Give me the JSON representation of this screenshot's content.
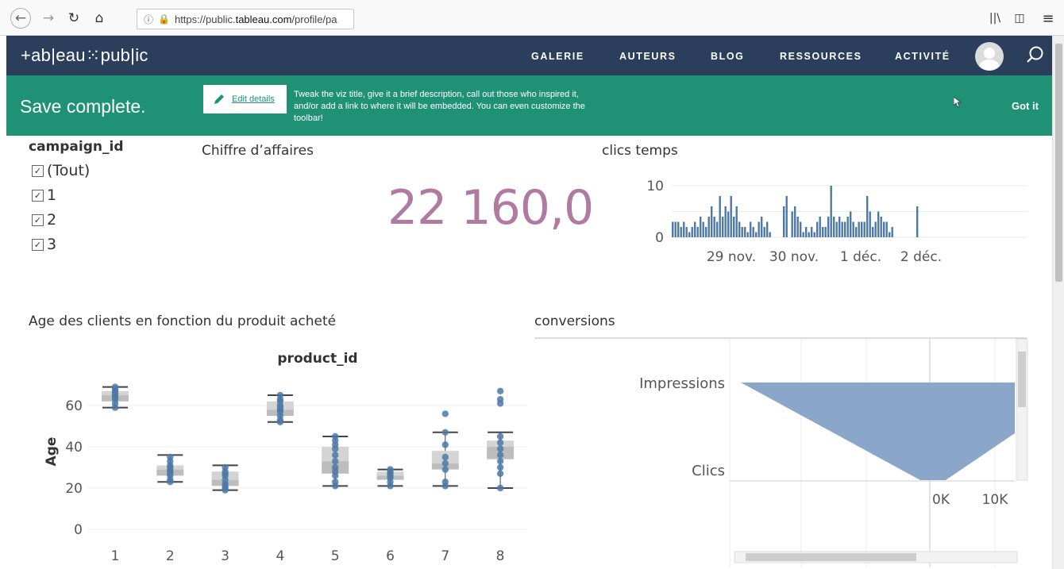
{
  "browser": {
    "url_prefix": "https://public.",
    "url_domain": "tableau.com",
    "url_path": "/profile/pa"
  },
  "header": {
    "logo": "+ableauⁱ⁺⁺public",
    "logo_text": "+ab|eau⁙pub|ic",
    "nav": [
      "GALERIE",
      "AUTEURS",
      "BLOG",
      "RESSOURCES",
      "ACTIVITÉ"
    ]
  },
  "banner": {
    "title": "Save complete.",
    "edit_label": "Edit details",
    "description": "Tweak the viz title, give it a brief description, call out those who inspired it, and/or add a link to where it will be embedded. You can even customize the toolbar!",
    "dismiss": "Got it"
  },
  "filter": {
    "title": "campaign_id",
    "items": [
      {
        "label": "(Tout)",
        "checked": true
      },
      {
        "label": "1",
        "checked": true
      },
      {
        "label": "2",
        "checked": true
      },
      {
        "label": "3",
        "checked": true
      }
    ]
  },
  "kpi": {
    "title": "Chiffre d’affaires",
    "value": "22 160,0"
  },
  "colors": {
    "header_bg": "#2b3f5c",
    "banner_bg": "#1f9276",
    "kpi": "#b07aa1",
    "mark": "#4e79a7",
    "funnel": "#8aa6c8"
  },
  "chart_data": [
    {
      "type": "bar",
      "title": "clics temps",
      "ylim": [
        0,
        12
      ],
      "yticks": [
        "10",
        "0"
      ],
      "xticks": [
        "29 nov.",
        "30 nov.",
        "1 déc.",
        "2 déc."
      ],
      "values": [
        3,
        3,
        3,
        2,
        3,
        2,
        1,
        2,
        3,
        2,
        4,
        3,
        2,
        4,
        6,
        4,
        3,
        8,
        4,
        6,
        5,
        8,
        4,
        6,
        3,
        2,
        2,
        1,
        3,
        2,
        1,
        3,
        4,
        2,
        3,
        1,
        0,
        0,
        0,
        0,
        6,
        8,
        0,
        5,
        6,
        4,
        3,
        1,
        2,
        1,
        2,
        1,
        3,
        4,
        2,
        2,
        4,
        10,
        4,
        3,
        4,
        3,
        3,
        4,
        5,
        3,
        2,
        3,
        3,
        3,
        8,
        5,
        2,
        3,
        5,
        4,
        3,
        3,
        1,
        2,
        0,
        0,
        0,
        0,
        0,
        0,
        0,
        0,
        6
      ],
      "grid": true
    },
    {
      "type": "box",
      "title": "Age des clients en fonction du produit acheté",
      "header": "product_id",
      "ylabel": "Age",
      "ylim": [
        0,
        75
      ],
      "yticks": [
        "60",
        "40",
        "20",
        "0"
      ],
      "categories": [
        "1",
        "2",
        "3",
        "4",
        "5",
        "6",
        "7",
        "8"
      ],
      "boxes": [
        {
          "min": 59,
          "q1": 62,
          "median": 65,
          "q3": 67,
          "max": 69,
          "points": [
            59,
            61,
            63,
            64,
            65,
            66,
            67,
            68,
            69
          ]
        },
        {
          "min": 23,
          "q1": 26,
          "median": 29,
          "q3": 31,
          "max": 36,
          "points": [
            23,
            24,
            26,
            27,
            28,
            29,
            30,
            31,
            33,
            35
          ]
        },
        {
          "min": 19,
          "q1": 21,
          "median": 24,
          "q3": 28,
          "max": 31,
          "points": [
            19,
            20,
            21,
            22,
            24,
            26,
            27,
            28,
            30
          ]
        },
        {
          "min": 52,
          "q1": 55,
          "median": 58,
          "q3": 62,
          "max": 65,
          "points": [
            52,
            53,
            55,
            57,
            58,
            59,
            60,
            62,
            63,
            65
          ]
        },
        {
          "min": 21,
          "q1": 27,
          "median": 33,
          "q3": 40,
          "max": 45,
          "points": [
            21,
            23,
            26,
            28,
            30,
            33,
            36,
            39,
            41,
            43,
            45
          ]
        },
        {
          "min": 21,
          "q1": 24,
          "median": 26,
          "q3": 28,
          "max": 29,
          "points": [
            21,
            23,
            25,
            26,
            27,
            28,
            29
          ]
        },
        {
          "min": 21,
          "q1": 29,
          "median": 32,
          "q3": 38,
          "max": 47,
          "points": [
            21,
            23,
            29,
            32,
            35,
            41,
            47,
            56
          ]
        },
        {
          "min": 20,
          "q1": 34,
          "median": 40,
          "q3": 43,
          "max": 47,
          "points": [
            20,
            27,
            30,
            33,
            36,
            39,
            42,
            45,
            61,
            63,
            67
          ]
        }
      ]
    },
    {
      "type": "area",
      "title": "conversions",
      "categories": [
        "Impressions",
        "Clics"
      ],
      "xticks": [
        "0K",
        "10K"
      ],
      "values": [
        10000,
        200
      ]
    }
  ]
}
